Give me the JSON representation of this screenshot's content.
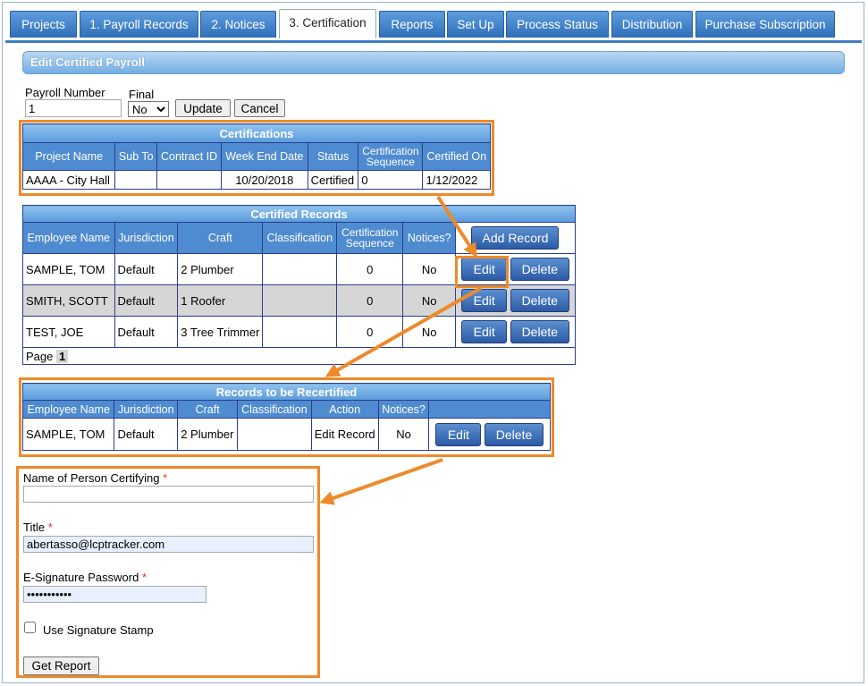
{
  "tabs": [
    {
      "label": "Projects"
    },
    {
      "label": "1. Payroll Records"
    },
    {
      "label": "2. Notices"
    },
    {
      "label": "3. Certification"
    },
    {
      "label": "Reports"
    },
    {
      "label": "Set Up"
    },
    {
      "label": "Process Status"
    },
    {
      "label": "Distribution"
    },
    {
      "label": "Purchase Subscription"
    }
  ],
  "section_title": "Edit Certified Payroll",
  "payroll": {
    "number_label": "Payroll Number",
    "number_value": "1",
    "final_label": "Final",
    "final_value": "No",
    "update_label": "Update",
    "cancel_label": "Cancel"
  },
  "certifications": {
    "title": "Certifications",
    "headers": {
      "project_name": "Project Name",
      "sub_to": "Sub To",
      "contract_id": "Contract ID",
      "week_end_date": "Week End Date",
      "status": "Status",
      "cert_seq_1": "Certification",
      "cert_seq_2": "Sequence",
      "certified_on": "Certified On"
    },
    "row": {
      "project_name": "AAAA - City Hall",
      "sub_to": "",
      "contract_id": "",
      "week_end_date": "10/20/2018",
      "status": "Certified",
      "sequence": "0",
      "certified_on": "1/12/2022"
    }
  },
  "certified_records": {
    "title": "Certified Records",
    "headers": {
      "employee_name": "Employee Name",
      "jurisdiction": "Jurisdiction",
      "craft": "Craft",
      "classification": "Classification",
      "cert_seq_1": "Certification",
      "cert_seq_2": "Sequence",
      "notices": "Notices?"
    },
    "add_record_label": "Add Record",
    "edit_label": "Edit",
    "delete_label": "Delete",
    "rows": [
      {
        "employee_name": "SAMPLE, TOM",
        "jurisdiction": "Default",
        "craft": "2 Plumber",
        "classification": "",
        "sequence": "0",
        "notices": "No"
      },
      {
        "employee_name": "SMITH, SCOTT",
        "jurisdiction": "Default",
        "craft": "1 Roofer",
        "classification": "",
        "sequence": "0",
        "notices": "No"
      },
      {
        "employee_name": "TEST, JOE",
        "jurisdiction": "Default",
        "craft": "3 Tree Trimmer",
        "classification": "",
        "sequence": "0",
        "notices": "No"
      }
    ],
    "page_label": "Page",
    "page_number": "1"
  },
  "recertify": {
    "title": "Records to be Recertified",
    "headers": {
      "employee_name": "Employee Name",
      "jurisdiction": "Jurisdiction",
      "craft": "Craft",
      "classification": "Classification",
      "action": "Action",
      "notices": "Notices?"
    },
    "row": {
      "employee_name": "SAMPLE, TOM",
      "jurisdiction": "Default",
      "craft": "2 Plumber",
      "classification": "",
      "action": "Edit Record",
      "notices": "No"
    },
    "edit_label": "Edit",
    "delete_label": "Delete"
  },
  "form": {
    "name_label": "Name of Person Certifying",
    "name_value": "",
    "title_label": "Title",
    "title_value": "abertasso@lcptracker.com",
    "password_label": "E-Signature Password",
    "password_value": "•••••••••••",
    "required_mark": "*",
    "stamp_label": "Use Signature Stamp",
    "get_report_label": "Get Report"
  },
  "colors": {
    "accent": "#3e7ec6",
    "highlight": "#ee8a2a",
    "table_border": "#2b3f8c"
  }
}
